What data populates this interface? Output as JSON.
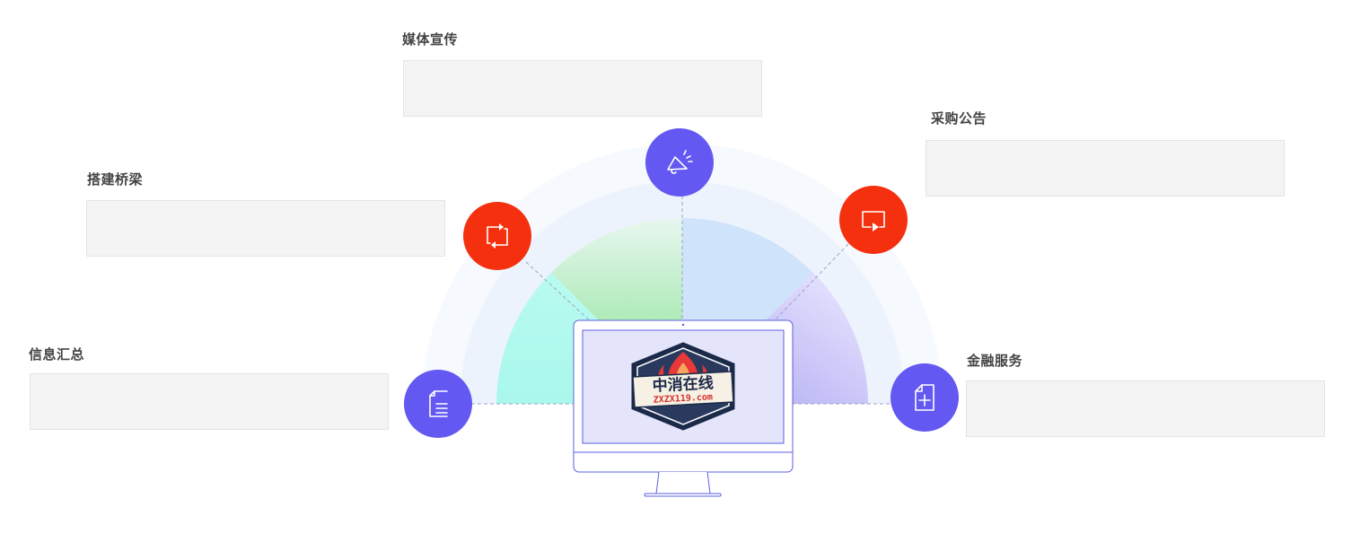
{
  "colors": {
    "purple": "#6358f2",
    "red": "#f5300f",
    "teal": "#a9f8ec",
    "green": "#7fe08a",
    "lightblue": "#cfe3fb",
    "lavender": "#a9a4f2",
    "ring_outer": "#f6f9fe",
    "ring_mid": "#eef3fd",
    "box_fill": "#f4f4f4",
    "title_text": "#444444"
  },
  "sections": {
    "media": {
      "title": "媒体宣传",
      "icon": "megaphone-icon"
    },
    "procurement": {
      "title": "采购公告",
      "icon": "screen-share-icon"
    },
    "bridge": {
      "title": "搭建桥梁",
      "icon": "swap-arrows-icon"
    },
    "info": {
      "title": "信息汇总",
      "icon": "document-list-icon"
    },
    "finance": {
      "title": "金融服务",
      "icon": "document-plus-icon"
    }
  },
  "monitor": {
    "logo_cn": "中消在线",
    "logo_url": "ZXZX119.com"
  }
}
